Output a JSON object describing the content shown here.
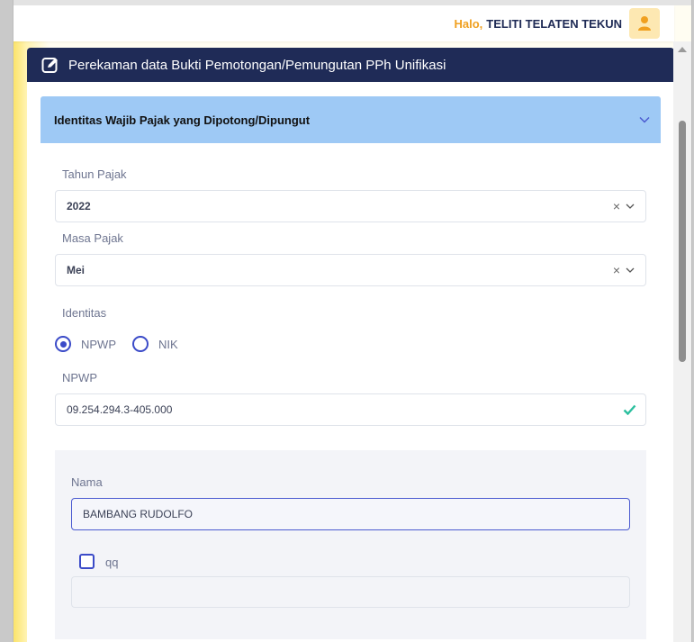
{
  "header": {
    "greeting": "Halo,",
    "user_name": "TELITI TELATEN TEKUN",
    "avatar_icon": "user-icon"
  },
  "card": {
    "title": "Perekaman data Bukti Pemotongan/Pemungutan PPh Unifikasi",
    "title_icon": "edit-icon"
  },
  "section": {
    "title": "Identitas Wajib Pajak yang Dipotong/Dipungut",
    "toggle_icon": "chevron-down-icon"
  },
  "form": {
    "tahun_pajak": {
      "label": "Tahun Pajak",
      "value": "2022"
    },
    "masa_pajak": {
      "label": "Masa Pajak",
      "value": "Mei"
    },
    "identitas": {
      "label": "Identitas",
      "options": [
        "NPWP",
        "NIK"
      ],
      "selected": "NPWP"
    },
    "npwp": {
      "label": "NPWP",
      "value": "09.254.294.3-405.000",
      "valid_icon": "check-icon"
    },
    "nama": {
      "label": "Nama",
      "value": "BAMBANG RUDOLFO"
    },
    "qq": {
      "label": "qq",
      "checked": false,
      "value": ""
    }
  },
  "colors": {
    "navy": "#1f2b57",
    "section_blue": "#9ec9f5",
    "accent": "#3b4bc8",
    "greeting_orange": "#f0a020",
    "check_green": "#2bbf9e"
  }
}
